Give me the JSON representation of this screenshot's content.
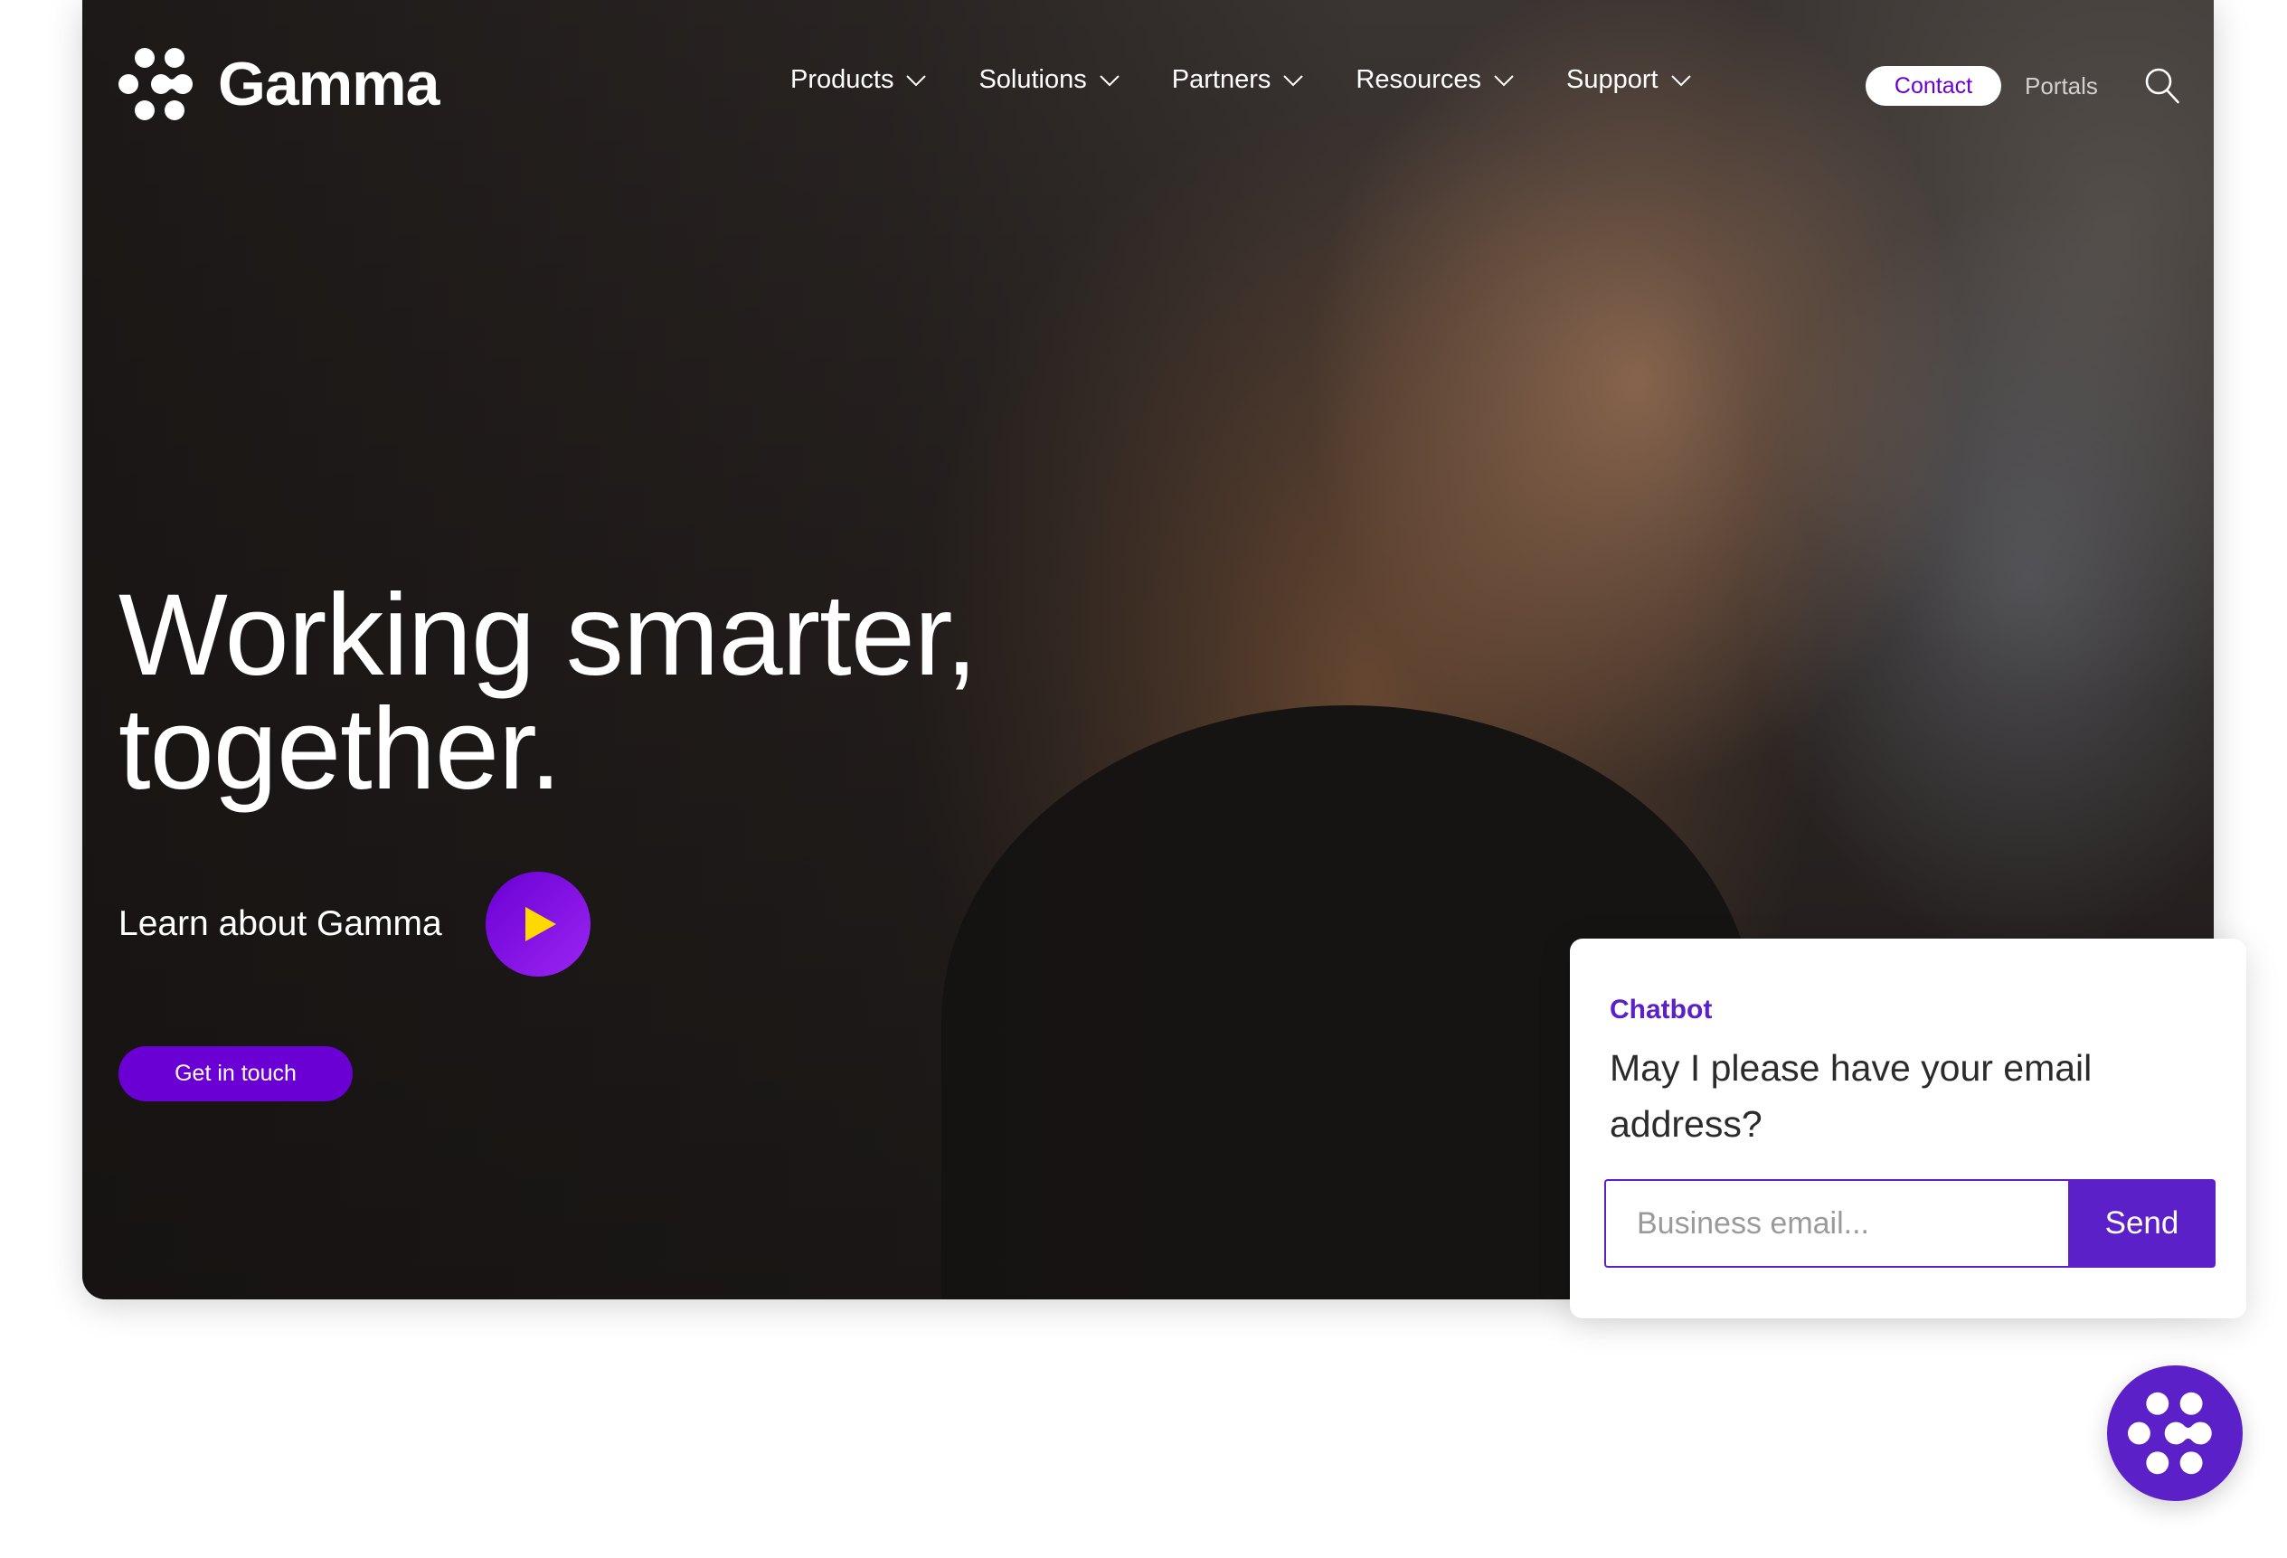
{
  "brand": {
    "name": "Gamma",
    "logo_icon": "gamma-dots-icon",
    "colors": {
      "primary": "#6a00d4",
      "chat_accent": "#5b20c8",
      "play_gradient_end": "#9b25f2",
      "play_icon": "#ffd800",
      "white": "#ffffff"
    }
  },
  "header": {
    "nav": [
      {
        "label": "Products",
        "icon": "chevron-down-icon"
      },
      {
        "label": "Solutions",
        "icon": "chevron-down-icon"
      },
      {
        "label": "Partners",
        "icon": "chevron-down-icon"
      },
      {
        "label": "Resources",
        "icon": "chevron-down-icon"
      },
      {
        "label": "Support",
        "icon": "chevron-down-icon"
      }
    ],
    "contact_label": "Contact",
    "portals_label": "Portals",
    "search_icon": "search-icon"
  },
  "hero": {
    "headline_line1": "Working smarter,",
    "headline_line2": "together.",
    "learn_label": "Learn about Gamma",
    "play_icon": "play-icon",
    "cta_label": "Get in touch",
    "background": "photo of smiling woman talking on a phone"
  },
  "chatbot": {
    "title": "Chatbot",
    "question": "May I please have your email address?",
    "input_value": "",
    "input_placeholder": "Business email...",
    "send_label": "Send",
    "launcher_icon": "gamma-dots-icon"
  }
}
